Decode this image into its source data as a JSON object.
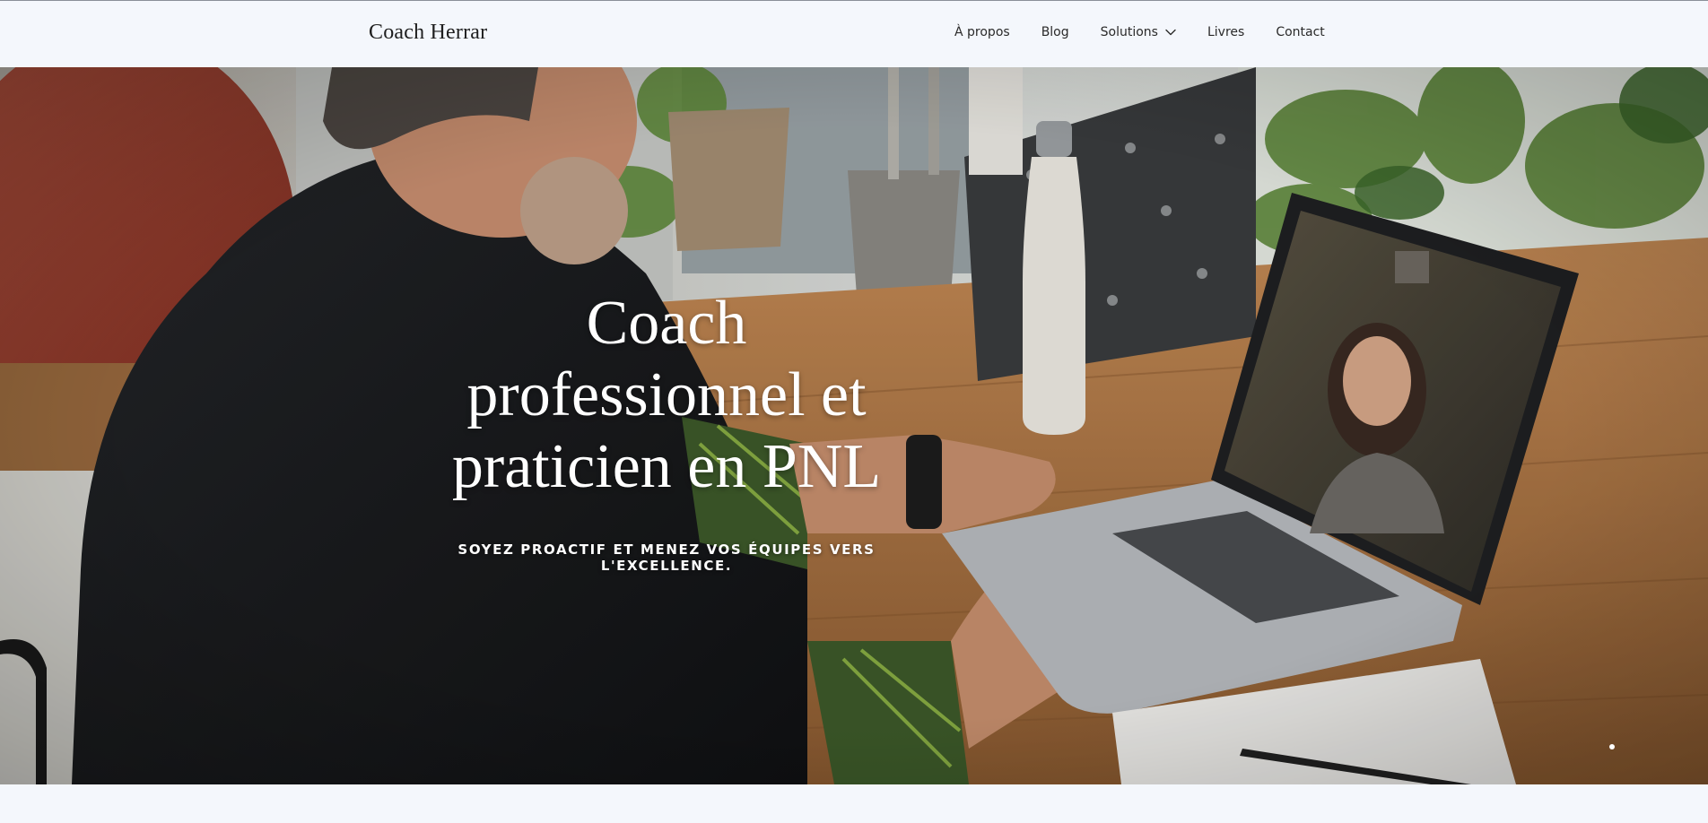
{
  "header": {
    "brand": "Coach Herrar",
    "nav": [
      {
        "label": "À propos"
      },
      {
        "label": "Blog"
      },
      {
        "label": "Solutions",
        "icon": "chevron-down-icon"
      },
      {
        "label": "Livres"
      },
      {
        "label": "Contact"
      }
    ]
  },
  "hero": {
    "title_lines": [
      "Coach",
      "professionnel et",
      "praticien en PNL"
    ],
    "subtitle": "SOYEZ PROACTIF ET MENEZ VOS ÉQUIPES VERS L'EXCELLENCE.",
    "image_description_icon": "coaching-photo",
    "slider": {
      "current_slide": 1
    }
  },
  "colors": {
    "background": "#f4f7fc",
    "text_dark": "#1e1e1e",
    "hero_text": "#ffffff"
  }
}
